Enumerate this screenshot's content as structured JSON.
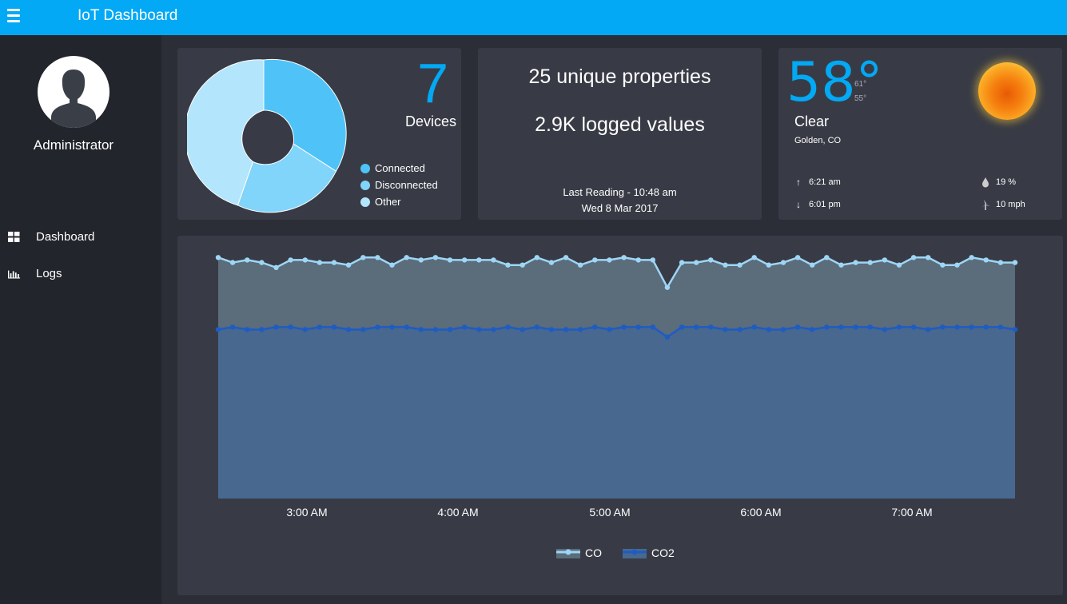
{
  "header": {
    "title": "IoT Dashboard"
  },
  "sidebar": {
    "user": "Administrator",
    "items": [
      {
        "label": "Dashboard",
        "icon": "dashboard-grid-icon"
      },
      {
        "label": "Logs",
        "icon": "bar-chart-icon"
      }
    ]
  },
  "devices": {
    "count": "7",
    "label": "Devices",
    "legend": [
      {
        "label": "Connected",
        "color": "#4fc3f7"
      },
      {
        "label": "Disconnected",
        "color": "#81d4fa"
      },
      {
        "label": "Other",
        "color": "#b3e5fc"
      }
    ]
  },
  "stats": {
    "properties": "25 unique properties",
    "logged": "2.9K logged values",
    "last_reading_time": "Last Reading - 10:48 am",
    "last_reading_date": "Wed 8 Mar 2017"
  },
  "weather": {
    "temp": "58°",
    "high": "61°",
    "low": "55°",
    "condition": "Clear",
    "location": "Golden, CO",
    "sunrise": "6:21 am",
    "sunset": "6:01 pm",
    "humidity": "19 %",
    "wind": "10 mph"
  },
  "chart_data": {
    "type": "area",
    "x_ticks": [
      "3:00 AM",
      "4:00 AM",
      "5:00 AM",
      "6:00 AM",
      "7:00 AM"
    ],
    "series": [
      {
        "name": "CO",
        "color": "#9ed6f5",
        "fill": "#5b6c7a",
        "values": [
          0.97,
          0.95,
          0.96,
          0.95,
          0.93,
          0.96,
          0.96,
          0.95,
          0.95,
          0.94,
          0.97,
          0.97,
          0.94,
          0.97,
          0.96,
          0.97,
          0.96,
          0.96,
          0.96,
          0.96,
          0.94,
          0.94,
          0.97,
          0.95,
          0.97,
          0.94,
          0.96,
          0.96,
          0.97,
          0.96,
          0.96,
          0.85,
          0.95,
          0.95,
          0.96,
          0.94,
          0.94,
          0.97,
          0.94,
          0.95,
          0.97,
          0.94,
          0.97,
          0.94,
          0.95,
          0.95,
          0.96,
          0.94,
          0.97,
          0.97,
          0.94,
          0.94,
          0.97,
          0.96,
          0.95,
          0.95
        ]
      },
      {
        "name": "CO2",
        "color": "#1e5cc4",
        "fill": "#48688f",
        "values": [
          0.68,
          0.69,
          0.68,
          0.68,
          0.69,
          0.69,
          0.68,
          0.69,
          0.69,
          0.68,
          0.68,
          0.69,
          0.69,
          0.69,
          0.68,
          0.68,
          0.68,
          0.69,
          0.68,
          0.68,
          0.69,
          0.68,
          0.69,
          0.68,
          0.68,
          0.68,
          0.69,
          0.68,
          0.69,
          0.69,
          0.69,
          0.65,
          0.69,
          0.69,
          0.69,
          0.68,
          0.68,
          0.69,
          0.68,
          0.68,
          0.69,
          0.68,
          0.69,
          0.69,
          0.69,
          0.69,
          0.68,
          0.69,
          0.69,
          0.68,
          0.69,
          0.69,
          0.69,
          0.69,
          0.69,
          0.68
        ]
      }
    ],
    "ylim": [
      0,
      1
    ]
  }
}
